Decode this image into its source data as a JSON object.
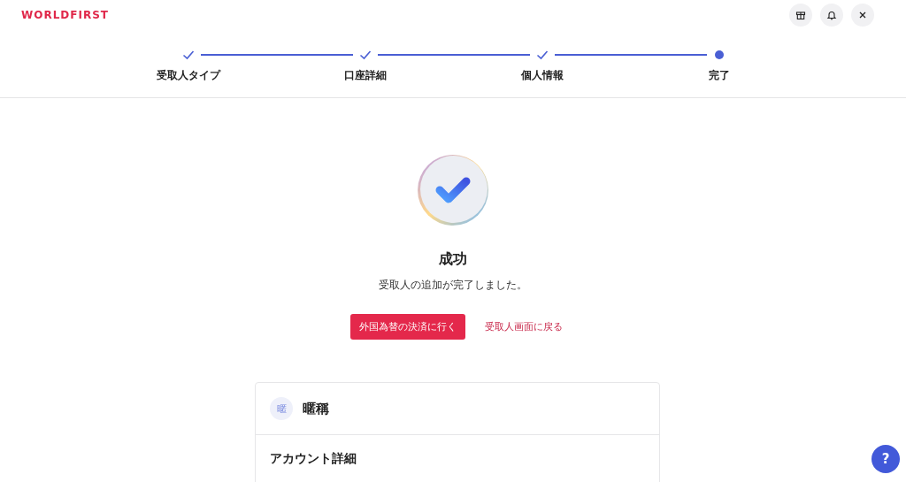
{
  "brand": "WORLDFIRST",
  "steps": [
    {
      "label": "受取人タイプ",
      "done": true
    },
    {
      "label": "口座詳細",
      "done": true
    },
    {
      "label": "個人情報",
      "done": true
    },
    {
      "label": "完了",
      "done": false
    }
  ],
  "result": {
    "title": "成功",
    "message": "受取人の追加が完了しました。"
  },
  "actions": {
    "primary": "外国為替の決済に行く",
    "link": "受取人画面に戻る"
  },
  "card": {
    "avatar": "暱",
    "name": "暱稱",
    "section_title": "アカウント詳細"
  },
  "help": {
    "label": "?"
  }
}
